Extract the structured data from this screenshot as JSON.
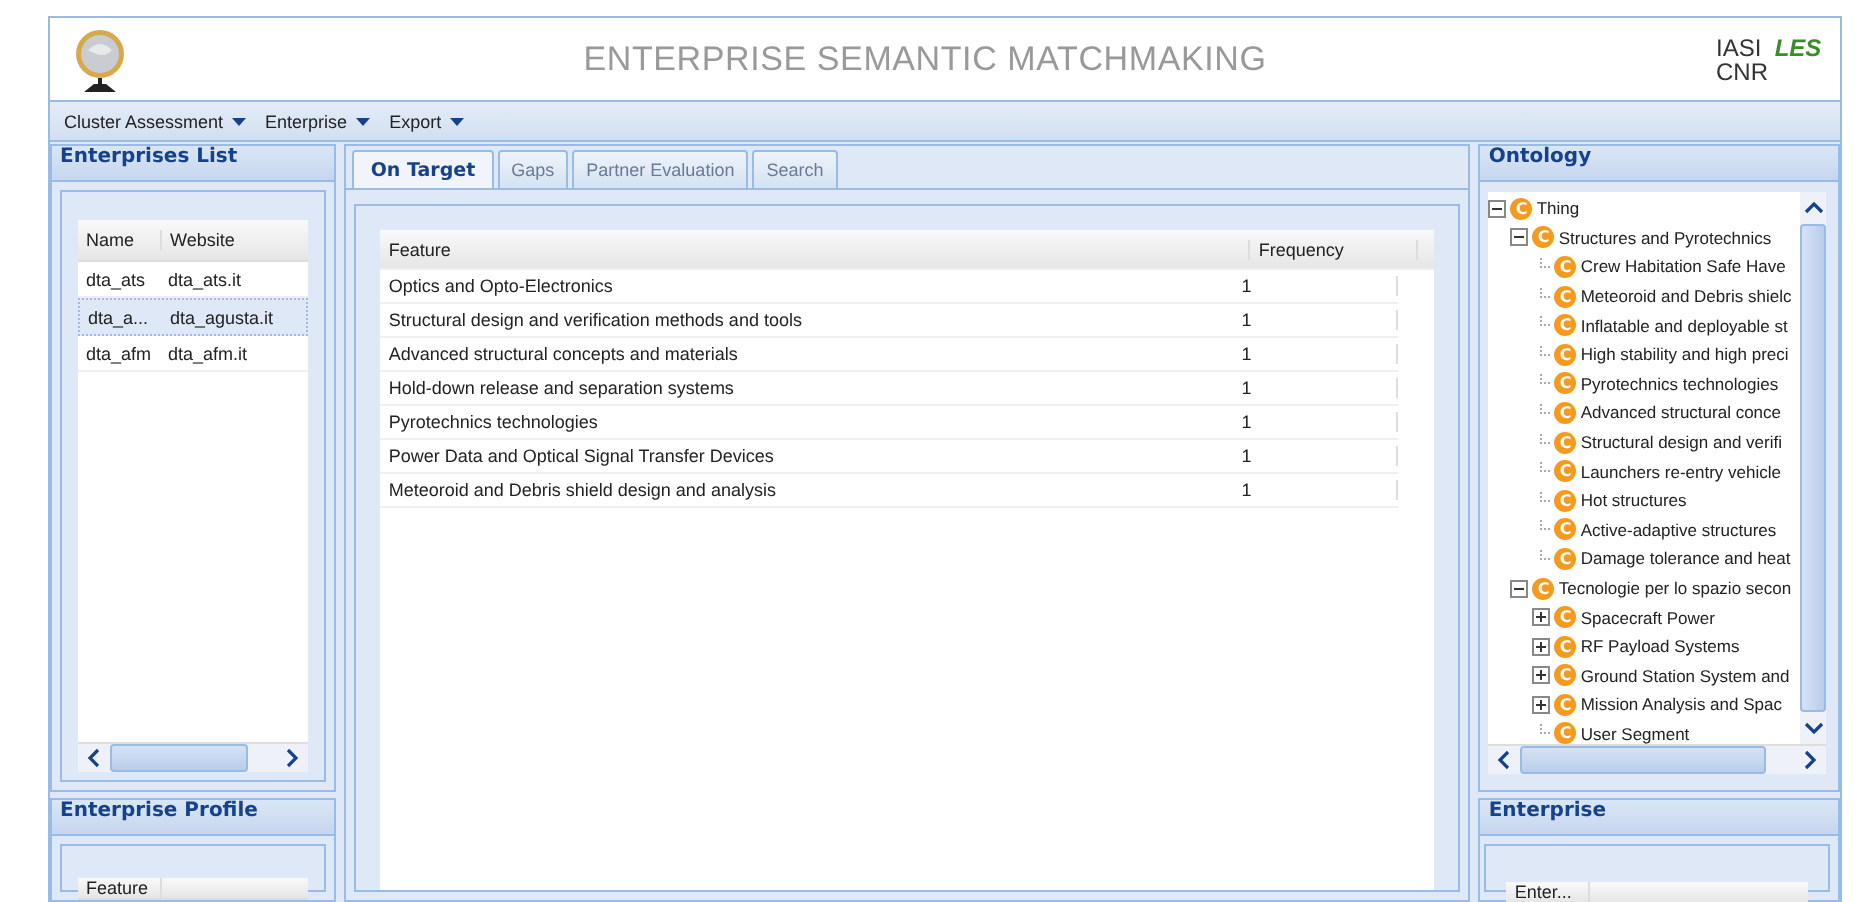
{
  "header": {
    "title": "ENTERPRISE SEMANTIC MATCHMAKING",
    "logo_text": [
      "IASI",
      "CNR",
      "LES"
    ]
  },
  "menu": [
    {
      "label": "Cluster Assessment"
    },
    {
      "label": "Enterprise"
    },
    {
      "label": "Export"
    }
  ],
  "enterprises_list": {
    "title": "Enterprises List",
    "columns": [
      "Name",
      "Website"
    ],
    "rows": [
      {
        "cells": [
          "dta_ats",
          "dta_ats.it"
        ],
        "selected": false
      },
      {
        "cells": [
          "dta_a...",
          "dta_agusta.it"
        ],
        "selected": true
      },
      {
        "cells": [
          "dta_afm",
          "dta_afm.it"
        ],
        "selected": false
      }
    ]
  },
  "enterprise_profile": {
    "title": "Enterprise Profile",
    "columns": [
      "Feature"
    ]
  },
  "tabs": [
    {
      "label": "On Target",
      "selected": true
    },
    {
      "label": "Gaps",
      "selected": false
    },
    {
      "label": "Partner Evaluation",
      "selected": false
    },
    {
      "label": "Search",
      "selected": false
    }
  ],
  "table": {
    "columns": [
      "Feature",
      "Frequency"
    ],
    "rows": [
      [
        "Optics and Opto-Electronics",
        "1"
      ],
      [
        "Structural design and verification methods and tools",
        "1"
      ],
      [
        "Advanced structural concepts and materials",
        "1"
      ],
      [
        "Hold-down release and separation systems",
        "1"
      ],
      [
        "Pyrotechnics technologies",
        "1"
      ],
      [
        "Power Data and Optical Signal Transfer Devices",
        "1"
      ],
      [
        "Meteoroid and Debris shield design and analysis",
        "1"
      ]
    ]
  },
  "ontology": {
    "title": "Ontology",
    "tree": [
      {
        "badge": "C",
        "label": "Thing",
        "expanded": true,
        "children": [
          {
            "badge": "C",
            "label": "Structures and Pyrotechnics",
            "expanded": true,
            "children": [
              {
                "badge": "C",
                "label": "Crew Habitation Safe Have"
              },
              {
                "badge": "C",
                "label": "Meteoroid and Debris shielc"
              },
              {
                "badge": "C",
                "label": "Inflatable and deployable st"
              },
              {
                "badge": "C",
                "label": "High stability and high preci"
              },
              {
                "badge": "C",
                "label": "Pyrotechnics technologies"
              },
              {
                "badge": "C",
                "label": "Advanced structural conce"
              },
              {
                "badge": "C",
                "label": "Structural design and verifi"
              },
              {
                "badge": "C",
                "label": "Launchers re-entry vehicle"
              },
              {
                "badge": "C",
                "label": "Hot structures"
              },
              {
                "badge": "C",
                "label": "Active-adaptive structures"
              },
              {
                "badge": "C",
                "label": "Damage tolerance and heat"
              }
            ]
          },
          {
            "badge": "C",
            "label": "Tecnologie per lo spazio secon",
            "expanded": true,
            "children": [
              {
                "badge": "C",
                "label": "Spacecraft Power",
                "expanded": false
              },
              {
                "badge": "C",
                "label": "RF Payload Systems",
                "expanded": false
              },
              {
                "badge": "C",
                "label": "Ground Station System and",
                "expanded": false
              },
              {
                "badge": "C",
                "label": "Mission Analysis and Spac",
                "expanded": false
              },
              {
                "badge": "C",
                "label": "User Segment"
              }
            ]
          }
        ]
      }
    ]
  },
  "enterprise": {
    "title": "Enterprise",
    "columns": [
      "Enter..."
    ]
  }
}
